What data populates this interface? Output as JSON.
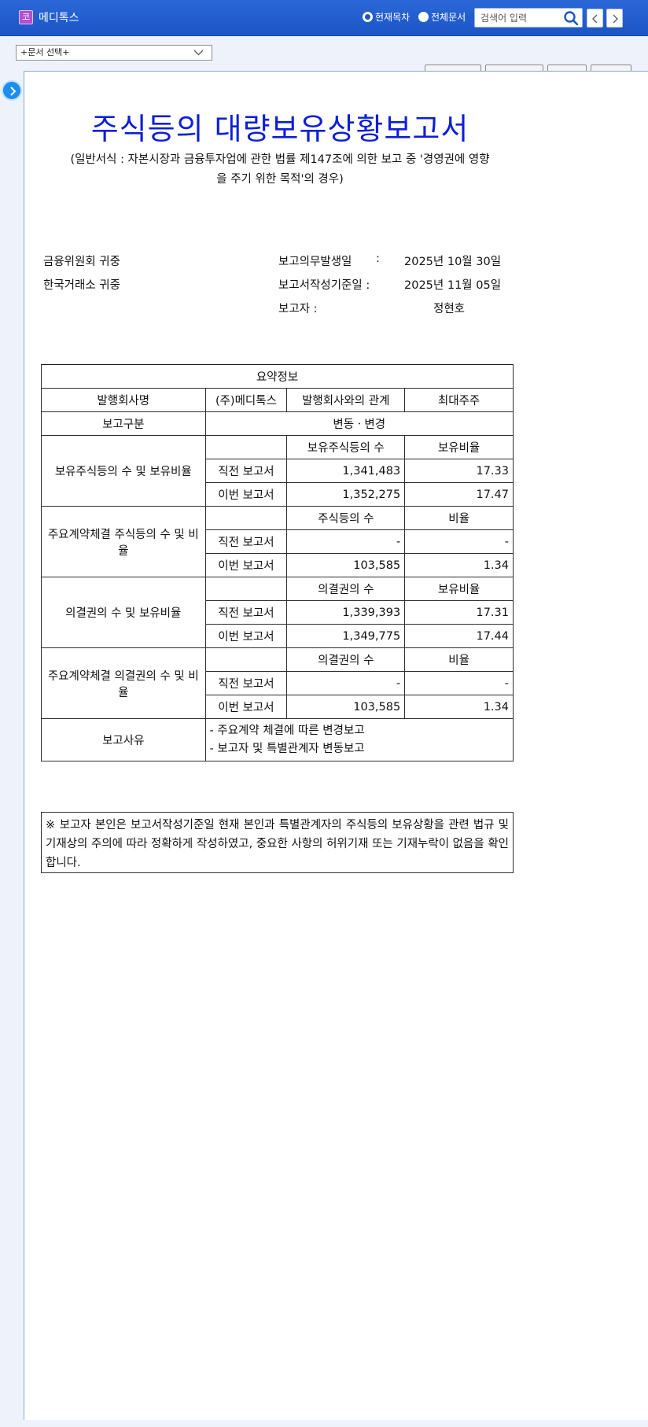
{
  "header": {
    "corp_badge": "코",
    "corp_name": "메디톡스",
    "scope_current": "현재목차",
    "scope_all": "전체문서",
    "search_placeholder": "검색어 입력"
  },
  "doc_select": {
    "selected": "+문서 선택+"
  },
  "document": {
    "title": "주식등의 대량보유상황보고서",
    "subtitle_line1": "(일반서식 : 자본시장과 금융투자업에 관한 법률 제147조에 의한 보고 중 '경영권에 영향",
    "subtitle_line2": "을 주기 위한 목적'의 경우)",
    "addressee1": "금융위원회 귀중",
    "addressee2": "한국거래소 귀중",
    "obligation_date_label": "보고의무발생일",
    "obligation_date_sep": ":",
    "obligation_date": "2025년 10월 30일",
    "base_date_label": "보고서작성기준일 :",
    "base_date": "2025년 11월 05일",
    "reporter_label": "보고자 :",
    "reporter": "정현호"
  },
  "summary": {
    "title": "요약정보",
    "issuer_label": "발행회사명",
    "issuer": "(주)메디톡스",
    "relation_label": "발행회사와의 관계",
    "relation": "최대주주",
    "report_type_label": "보고구분",
    "report_type": "변동ㆍ변경",
    "prev_label": "직전 보고서",
    "curr_label": "이번 보고서",
    "holdings": {
      "label": "보유주식등의 수 및 보유비율",
      "col1": "보유주식등의 수",
      "col2": "보유비율",
      "prev": [
        "1,341,483",
        "17.33"
      ],
      "curr": [
        "1,352,275",
        "17.47"
      ]
    },
    "contract_shares": {
      "label": "주요계약체결 주식등의 수 및 비율",
      "col1": "주식등의 수",
      "col2": "비율",
      "prev": [
        "-",
        "-"
      ],
      "curr": [
        "103,585",
        "1.34"
      ]
    },
    "voting": {
      "label": "의결권의 수 및 보유비율",
      "col1": "의결권의 수",
      "col2": "보유비율",
      "prev": [
        "1,339,393",
        "17.31"
      ],
      "curr": [
        "1,349,775",
        "17.44"
      ]
    },
    "contract_voting": {
      "label": "주요계약체결 의결권의 수 및 비율",
      "col1": "의결권의 수",
      "col2": "비율",
      "prev": [
        "-",
        "-"
      ],
      "curr": [
        "103,585",
        "1.34"
      ]
    },
    "reason_label": "보고사유",
    "reasons": [
      "- 주요계약 체결에 따른 변경보고",
      "- 보고자 및 특별관계자 변동보고"
    ]
  },
  "notice": "※ 보고자 본인은 보고서작성기준일 현재 본인과 특별관계자의 주식등의 보유상황을 관련 법규 및 기재상의 주의에 따라 정확하게 작성하였고, 중요한 사항의 허위기재 또는 기재누락이 없음을 확인합니다.",
  "colors": {
    "header_bg": "#1c56c6",
    "title": "#0d1fd8",
    "toggle": "#1d8ef0"
  }
}
